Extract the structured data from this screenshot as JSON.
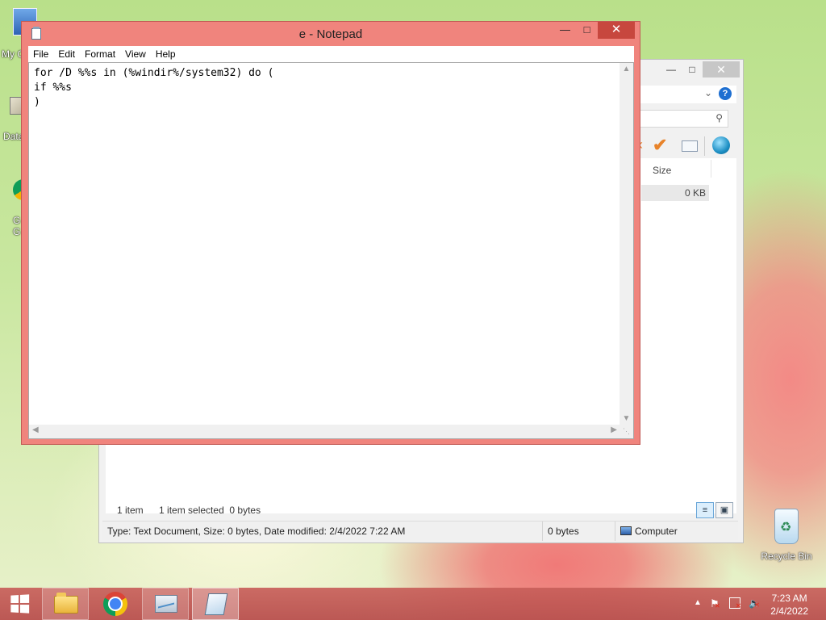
{
  "desktop": {
    "icons": [
      {
        "label": "My C"
      },
      {
        "label": "Data"
      },
      {
        "label": "G\nG"
      },
      {
        "label": "Recycle Bin"
      }
    ]
  },
  "notepad": {
    "title": "e - Notepad",
    "menu": [
      "File",
      "Edit",
      "Format",
      "View",
      "Help"
    ],
    "content": "for /D %%s in (%windir%/system32) do (\nif %%s\n)"
  },
  "explorer": {
    "column_size": "Size",
    "row_size": "0 KB",
    "status_items": "1 item",
    "status_selected": "1 item selected  0 bytes",
    "details": "Type: Text Document, Size: 0 bytes, Date modified: 2/4/2022 7:22 AM",
    "details_size": "0 bytes",
    "details_location": "Computer"
  },
  "taskbar": {
    "time": "7:23 AM",
    "date": "2/4/2022"
  },
  "colors": {
    "accent": "#f0847d",
    "close": "#c7473e",
    "help": "#1e6fd1"
  }
}
